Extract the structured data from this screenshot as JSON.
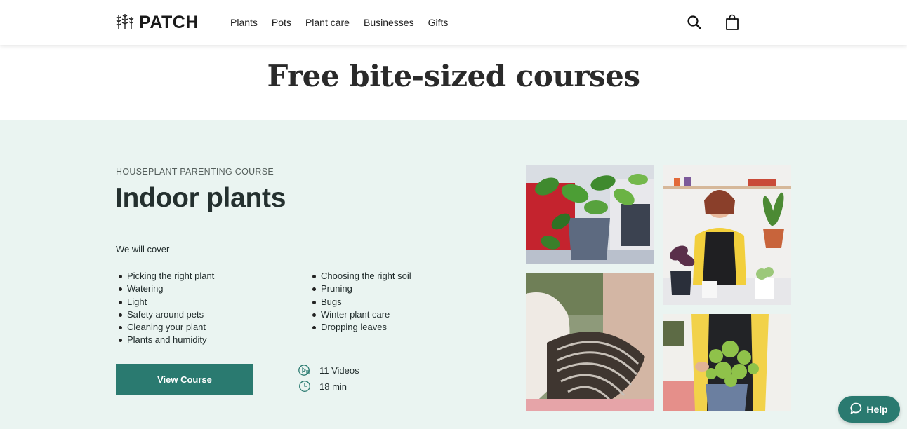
{
  "header": {
    "logo_text": "PATCH",
    "nav": [
      "Plants",
      "Pots",
      "Plant care",
      "Businesses",
      "Gifts"
    ],
    "icons": {
      "search": "search-icon",
      "bag": "shopping-bag-icon",
      "logo": "plant-logo-icon"
    }
  },
  "page_title": "Free bite-sized courses",
  "course": {
    "eyebrow": "HOUSEPLANT PARENTING COURSE",
    "title": "Indoor plants",
    "cover_label": "We will cover",
    "topics_left": [
      "Picking the right plant",
      "Watering",
      "Light",
      "Safety around pets",
      "Cleaning your plant",
      "Plants and humidity"
    ],
    "topics_right": [
      "Choosing the right soil",
      "Pruning",
      "Bugs",
      "Winter plant care",
      "Dropping leaves"
    ],
    "button_label": "View Course",
    "videos": "11 Videos",
    "duration": "18 min"
  },
  "help_label": "Help",
  "colors": {
    "accent": "#2a7a70",
    "section_bg": "#eaf4f1"
  }
}
